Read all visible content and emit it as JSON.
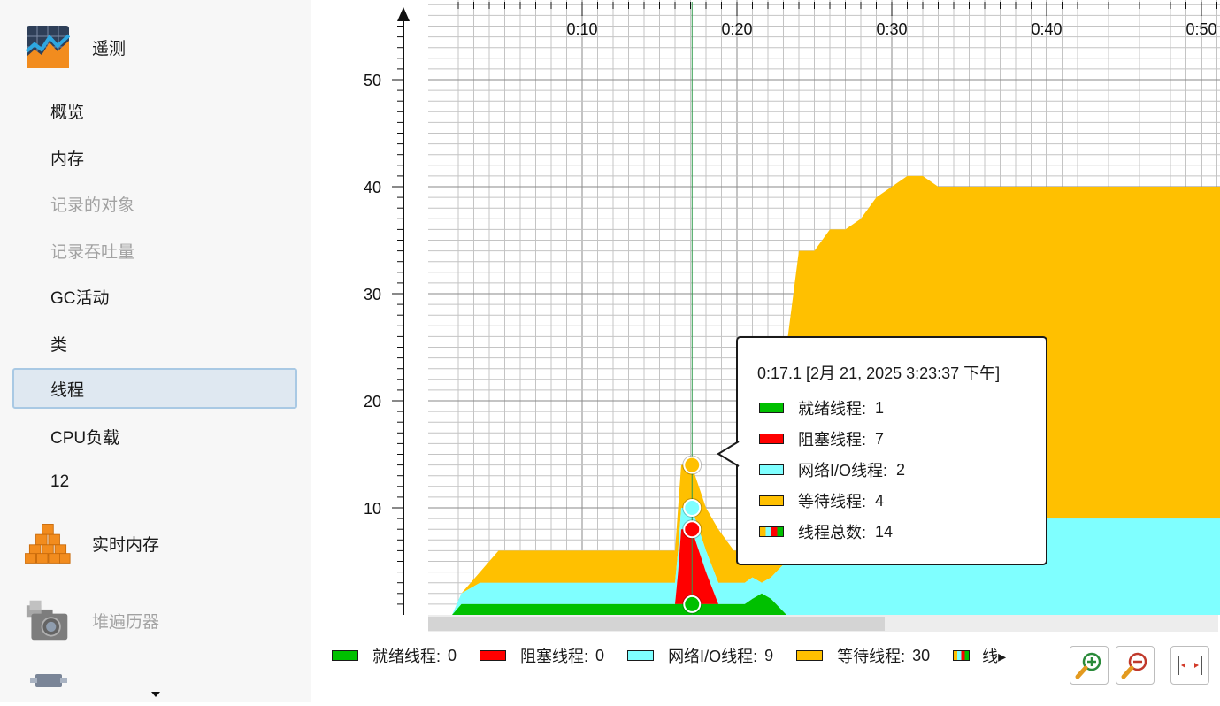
{
  "sidebar": {
    "telemetry_title": "遥测",
    "items": [
      {
        "label": "概览",
        "state": "normal"
      },
      {
        "label": "内存",
        "state": "normal"
      },
      {
        "label": "记录的对象",
        "state": "disabled"
      },
      {
        "label": "记录吞吐量",
        "state": "disabled"
      },
      {
        "label": "GC活动",
        "state": "normal"
      },
      {
        "label": "类",
        "state": "normal"
      },
      {
        "label": "线程",
        "state": "selected"
      },
      {
        "label": "CPU负载",
        "state": "normal"
      },
      {
        "label": "12",
        "state": "normal"
      }
    ],
    "live_memory_title": "实时内存",
    "heap_walker_title": "堆遍历器",
    "bottom_dropdown_icon": "chevron-down-icon"
  },
  "colors": {
    "runnable": "#00c000",
    "blocked": "#ff0000",
    "net_io": "#7fffff",
    "waiting": "#ffc000"
  },
  "chart_data": {
    "type": "area",
    "stacked": true,
    "x_ticks": [
      "0:10",
      "0:20",
      "0:30",
      "0:40",
      "0:50"
    ],
    "y_ticks": [
      10,
      20,
      30,
      40,
      50
    ],
    "xlim_seconds": [
      1.6,
      52
    ],
    "ylim": [
      0,
      57
    ],
    "x_seconds": [
      1.6,
      2.2,
      3.4,
      4.6,
      12,
      16,
      16.2,
      16.4,
      16.8,
      17.1,
      17.3,
      18,
      18.8,
      19.8,
      20.5,
      21,
      21.6,
      22.2,
      23.2,
      24,
      25,
      26,
      27,
      28,
      29,
      30,
      31,
      32,
      33,
      51.2,
      51.6
    ],
    "series": [
      {
        "name": "就绪线程",
        "key": "runnable",
        "values": [
          0,
          1,
          1,
          1,
          1,
          1,
          1,
          1,
          1,
          1,
          1,
          1,
          1,
          1,
          1,
          1.5,
          2,
          1.5,
          0,
          0,
          0,
          0,
          0,
          0,
          0,
          0,
          0,
          0,
          0,
          0,
          0
        ]
      },
      {
        "name": "阻塞线程",
        "key": "blocked",
        "values": [
          0,
          0,
          0,
          0,
          0,
          0,
          3,
          7,
          7,
          7,
          6,
          3,
          0,
          0,
          0,
          0,
          0,
          0,
          0,
          0,
          0,
          0,
          0,
          0,
          0,
          0,
          0,
          0,
          0,
          0,
          0
        ]
      },
      {
        "name": "网络I/O线程",
        "key": "net_io",
        "values": [
          0,
          1,
          2,
          2,
          2,
          2,
          2,
          2,
          2,
          2,
          2,
          2,
          2,
          2,
          2,
          2,
          1,
          2,
          5,
          7,
          8,
          8,
          8,
          8,
          9,
          9,
          9,
          9,
          9,
          9,
          9
        ]
      },
      {
        "name": "等待线程",
        "key": "waiting",
        "values": [
          0,
          0,
          1,
          3,
          3,
          3,
          4,
          4,
          4,
          4,
          4,
          4,
          5,
          3,
          3,
          3,
          3,
          5,
          20,
          27,
          26,
          28,
          28,
          29,
          30,
          31,
          32,
          32,
          31,
          31,
          30
        ]
      }
    ],
    "crosshair_seconds": 17.1
  },
  "tooltip": {
    "title": "0:17.1 [2月 21, 2025 3:23:37 下午]",
    "rows": [
      {
        "label": "就绪线程:",
        "value": "1",
        "key": "runnable"
      },
      {
        "label": "阻塞线程:",
        "value": "7",
        "key": "blocked"
      },
      {
        "label": "网络I/O线程:",
        "value": "2",
        "key": "net_io"
      },
      {
        "label": "等待线程:",
        "value": "4",
        "key": "waiting"
      },
      {
        "label": "线程总数:",
        "value": "14",
        "key": "total"
      }
    ]
  },
  "legend": {
    "items": [
      {
        "label": "就绪线程:",
        "value": "0",
        "key": "runnable"
      },
      {
        "label": "阻塞线程:",
        "value": "0",
        "key": "blocked"
      },
      {
        "label": "网络I/O线程:",
        "value": "9",
        "key": "net_io"
      },
      {
        "label": "等待线程:",
        "value": "30",
        "key": "waiting"
      }
    ],
    "overflow_label": "线▸"
  },
  "toolbar": {
    "zoom_in_icon": "zoom-in-icon",
    "zoom_out_icon": "zoom-out-icon",
    "fit_icon": "fit-width-icon"
  }
}
